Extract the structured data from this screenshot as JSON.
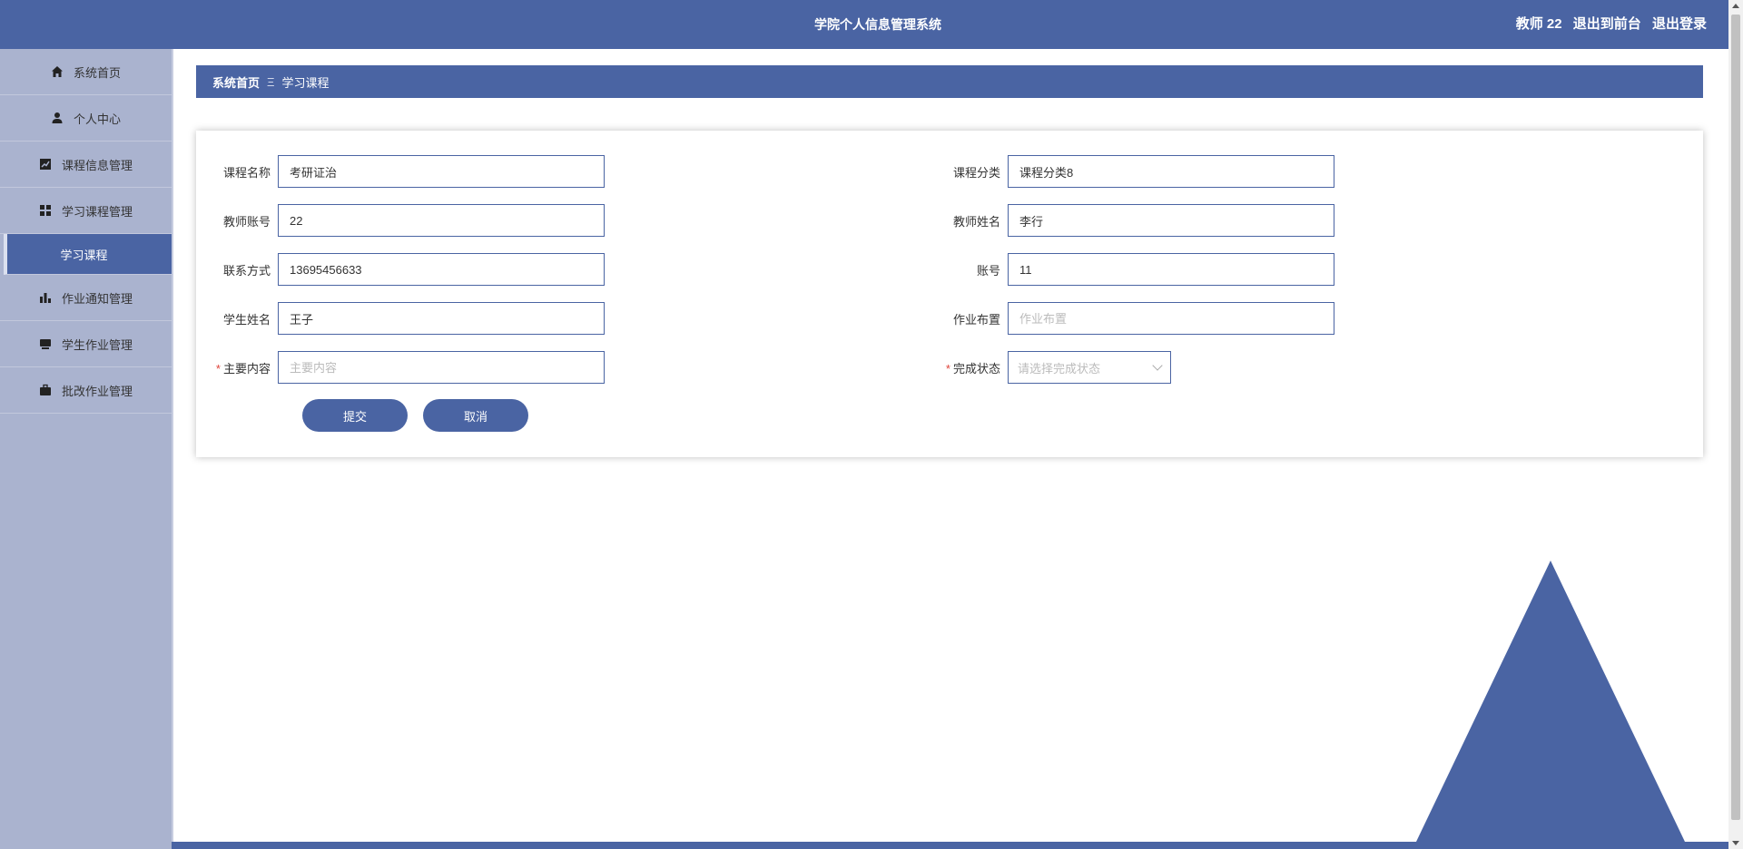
{
  "header": {
    "title": "学院个人信息管理系统",
    "user": "教师 22",
    "to_front": "退出到前台",
    "logout": "退出登录"
  },
  "sidebar": {
    "items": [
      {
        "label": "系统首页",
        "icon": "home-icon"
      },
      {
        "label": "个人中心",
        "icon": "user-icon"
      },
      {
        "label": "课程信息管理",
        "icon": "chart-line-icon"
      },
      {
        "label": "学习课程管理",
        "icon": "grid-icon"
      },
      {
        "label": "学习课程",
        "icon": ""
      },
      {
        "label": "作业通知管理",
        "icon": "bar-chart-icon"
      },
      {
        "label": "学生作业管理",
        "icon": "monitor-icon"
      },
      {
        "label": "批改作业管理",
        "icon": "briefcase-icon"
      }
    ]
  },
  "breadcrumb": {
    "home": "系统首页",
    "separator": "Ξ",
    "current": "学习课程"
  },
  "form": {
    "course_name": {
      "label": "课程名称",
      "value": "考研证治"
    },
    "course_category": {
      "label": "课程分类",
      "value": "课程分类8"
    },
    "teacher_account": {
      "label": "教师账号",
      "value": "22"
    },
    "teacher_name": {
      "label": "教师姓名",
      "value": "李行"
    },
    "contact": {
      "label": "联系方式",
      "value": "13695456633"
    },
    "account": {
      "label": "账号",
      "value": "11"
    },
    "student_name": {
      "label": "学生姓名",
      "value": "王子"
    },
    "assignment": {
      "label": "作业布置",
      "value": "",
      "placeholder": "作业布置"
    },
    "main_content": {
      "label": "主要内容",
      "value": "",
      "placeholder": "主要内容",
      "required": "*"
    },
    "status": {
      "label": "完成状态",
      "placeholder": "请选择完成状态",
      "required": "*"
    },
    "submit": "提交",
    "cancel": "取消"
  },
  "colors": {
    "primary": "#4a64a3",
    "sidebar": "#aab3cf",
    "required": "#e0443a"
  }
}
